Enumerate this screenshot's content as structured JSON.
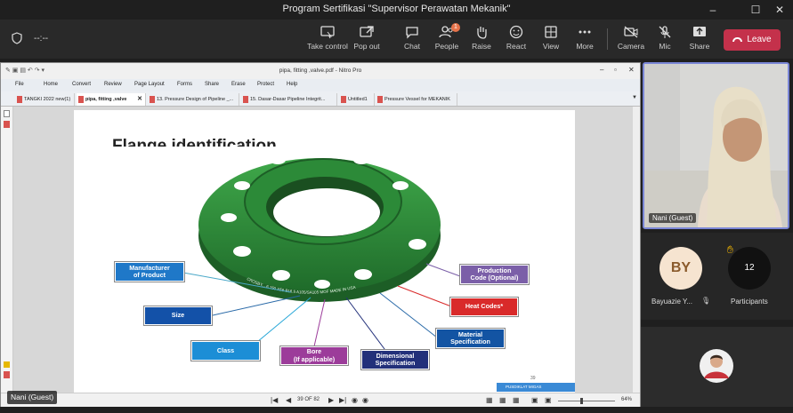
{
  "window": {
    "title": "Program Sertifikasi \"Supervisor Perawatan Mekanik\"",
    "minimize": "–",
    "maximize": "☐",
    "close": "✕"
  },
  "meeting_toolbar": {
    "timer": "--:--",
    "buttons": [
      {
        "label": "Take control",
        "icon": "take-control-icon"
      },
      {
        "label": "Pop out",
        "icon": "pop-out-icon"
      },
      {
        "label": "Chat",
        "icon": "chat-icon"
      },
      {
        "label": "People",
        "icon": "people-icon",
        "badge": "1"
      },
      {
        "label": "Raise",
        "icon": "raise-hand-icon"
      },
      {
        "label": "React",
        "icon": "react-icon"
      },
      {
        "label": "View",
        "icon": "view-icon"
      },
      {
        "label": "More",
        "icon": "more-icon"
      },
      {
        "label": "Camera",
        "icon": "camera-icon"
      },
      {
        "label": "Mic",
        "icon": "mic-off-icon"
      },
      {
        "label": "Share",
        "icon": "share-icon"
      }
    ],
    "leave_label": "Leave",
    "leave_color": "#c4314b"
  },
  "nitro": {
    "title": "pipa, fitting ,valve.pdf - Nitro Pro",
    "menu": [
      "File",
      "Home",
      "Convert",
      "Review",
      "Page Layout",
      "Forms",
      "Share",
      "Erase",
      "Protect",
      "Help"
    ],
    "tabs": [
      {
        "label": "TANGKI 2022 new(1)"
      },
      {
        "label": "pipa, fitting ,valve",
        "active": true
      },
      {
        "label": "13. Pressure Design of Pipeline _..."
      },
      {
        "label": "15. Dasar-Dasar Pipeline Integrit..."
      },
      {
        "label": "Untitled1"
      },
      {
        "label": "Pressure Vessel for MEKANIK"
      }
    ],
    "page_heading": "Flange identification",
    "page_number_footer": "39",
    "footer_tag": "PUSDIKLAT  MIGAS",
    "status": {
      "page_indicator": "39 OF 82",
      "zoom": "64%"
    }
  },
  "diagram": {
    "flange_color": "#2e8b3a",
    "stamp_text": "CROSBY... 6  150  X56  B16.5  A105/SA105 MOF  MADE IN USA",
    "labels": [
      {
        "key": "manufacturer",
        "line1": "Manufacturer",
        "line2": "of Product",
        "color": "#1f78c8"
      },
      {
        "key": "size",
        "line1": "Size",
        "line2": "",
        "color": "#1351a8"
      },
      {
        "key": "class",
        "line1": "Class",
        "line2": "",
        "color": "#1c8ed6"
      },
      {
        "key": "bore",
        "line1": "Bore",
        "line2": "(If applicable)",
        "color": "#9c3c9a"
      },
      {
        "key": "dimensional",
        "line1": "Dimensional",
        "line2": "Specification",
        "color": "#22307a"
      },
      {
        "key": "material",
        "line1": "Material",
        "line2": "Specification",
        "color": "#1354a3"
      },
      {
        "key": "heat",
        "line1": "Heat Codes*",
        "line2": "",
        "color": "#d92a2a"
      },
      {
        "key": "production",
        "line1": "Production",
        "line2": "Code (Optional)",
        "color": "#7b5fa8"
      }
    ]
  },
  "participants": {
    "sharer_label": "Nani (Guest)",
    "video_name": "Nani (Guest)",
    "tile1_initials": "BY",
    "tile1_name": "Bayuazie Y...",
    "tile2_count": "12",
    "tile2_name": "Participants"
  }
}
